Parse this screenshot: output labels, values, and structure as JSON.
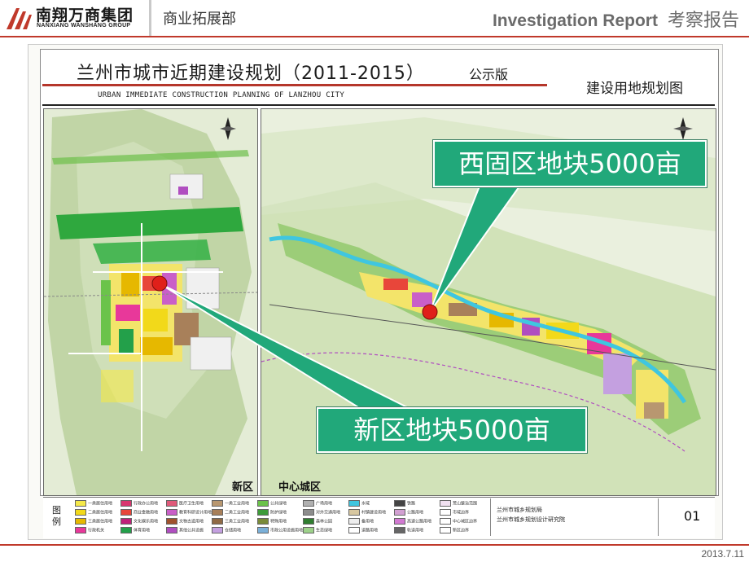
{
  "header": {
    "company_name_cn": "南翔万商集团",
    "company_name_en": "NANXIANG WANSHANG GROUP",
    "department": "商业拓展部",
    "report_title_en": "Investigation Report",
    "report_title_cn": "考察报告"
  },
  "document": {
    "title": "兰州市城市近期建设规划（2011-2015）",
    "version": "公示版",
    "subtitle": "URBAN IMMEDIATE CONSTRUCTION PLANNING OF LANZHOU CITY",
    "map_type": "建设用地规划图",
    "left_map_label": "新区",
    "right_map_label": "中心城区",
    "legend_title": "图例",
    "legend_items": [
      {
        "label": "一类居住用地",
        "color": "#f5e94a"
      },
      {
        "label": "二类居住用地",
        "color": "#f2d91a"
      },
      {
        "label": "三类居住用地",
        "color": "#e6b800"
      },
      {
        "label": "行政机关",
        "color": "#e8389a"
      },
      {
        "label": "行政办公用地",
        "color": "#d9366f"
      },
      {
        "label": "商业金融用地",
        "color": "#e8463a"
      },
      {
        "label": "文化娱乐用地",
        "color": "#c0207a"
      },
      {
        "label": "体育用地",
        "color": "#23a04a"
      },
      {
        "label": "医疗卫生用地",
        "color": "#e05a7a"
      },
      {
        "label": "教育科研设计用地",
        "color": "#c95fc8"
      },
      {
        "label": "文物古迹用地",
        "color": "#a0522d"
      },
      {
        "label": "其他公共设施",
        "color": "#b04ec0"
      },
      {
        "label": "一类工业用地",
        "color": "#b89770"
      },
      {
        "label": "二类工业用地",
        "color": "#a8805a"
      },
      {
        "label": "三类工业用地",
        "color": "#8f6a45"
      },
      {
        "label": "仓储用地",
        "color": "#c4a0e0"
      },
      {
        "label": "公共绿地",
        "color": "#6bc34a"
      },
      {
        "label": "防护绿地",
        "color": "#3e9b3a"
      },
      {
        "label": "特殊用地",
        "color": "#7a8b3a"
      },
      {
        "label": "市政公用设施用地",
        "color": "#7bb0d8"
      },
      {
        "label": "广场用地",
        "color": "#b0b0b0"
      },
      {
        "label": "对外交通用地",
        "color": "#8c8c8c"
      },
      {
        "label": "森林公园",
        "color": "#2f7d2f"
      },
      {
        "label": "生态绿地",
        "color": "#9dd18a"
      },
      {
        "label": "水域",
        "color": "#3fc6e0"
      },
      {
        "label": "村镇建设用地",
        "color": "#d7c7a0"
      },
      {
        "label": "备用地",
        "color": "#eeeeee"
      },
      {
        "label": "道路用地",
        "color": "#ffffff"
      },
      {
        "label": "铁路",
        "color": "#444444"
      },
      {
        "label": "公路用地",
        "color": "#d2a0d2"
      },
      {
        "label": "高速公路用地",
        "color": "#d27ad2"
      },
      {
        "label": "轨道用地",
        "color": "#666666"
      },
      {
        "label": "荒山整治范围",
        "color": "#f0e0f0"
      },
      {
        "label": "市域边界",
        "color": "#ffffff"
      },
      {
        "label": "中心城区边界",
        "color": "#ffffff"
      },
      {
        "label": "新区边界",
        "color": "#ffffff"
      }
    ],
    "org_line1": "兰州市城乡规划局",
    "org_line2": "兰州市城乡规划设计研究院",
    "page_number": "01"
  },
  "callouts": {
    "west_parcel": "西固区地块5000亩",
    "new_district_parcel": "新区地块5000亩"
  },
  "footer": {
    "date": "2013.7.11"
  },
  "colors": {
    "accent": "#c0392b",
    "callout": "#21a87a",
    "marker": "#e0201a"
  }
}
